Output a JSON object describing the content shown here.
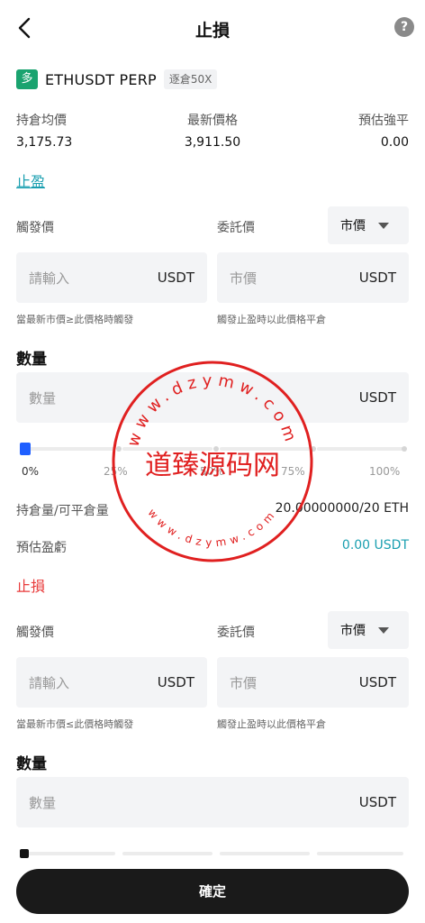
{
  "header": {
    "title": "止損",
    "help_icon": "help-circle-icon",
    "help_glyph": "?"
  },
  "symbol": {
    "direction": "多",
    "name": "ETHUSDT PERP",
    "mode": "逐倉50X",
    "direction_color": "#1aa36f"
  },
  "stats": {
    "labels": [
      "持倉均價",
      "最新價格",
      "預估強平"
    ],
    "values": [
      "3,175.73",
      "3,911.50",
      "0.00"
    ]
  },
  "take_profit": {
    "title": "止盈",
    "trigger_label": "觸發價",
    "order_label": "委託價",
    "order_type": "市價",
    "trigger_input": {
      "placeholder": "請輸入",
      "unit": "USDT"
    },
    "order_input": {
      "placeholder": "市價",
      "unit": "USDT"
    },
    "trigger_hint": "當最新市價≥此價格時觸發",
    "order_hint": "觸發止盈時以此價格平倉",
    "qty_title": "數量",
    "qty_input": {
      "placeholder": "數量",
      "unit": "USDT"
    },
    "slider_value_percent": 0,
    "slider_labels": [
      "0%",
      "25%",
      "50%",
      "75%",
      "100%"
    ],
    "position_label": "持倉量/可平倉量",
    "position_value": "20.00000000/20 ETH",
    "pnl_label": "預估盈虧",
    "pnl_value": "0.00 USDT"
  },
  "stop_loss": {
    "title": "止損",
    "trigger_label": "觸發價",
    "order_label": "委託價",
    "order_type": "市價",
    "trigger_input": {
      "placeholder": "請輸入",
      "unit": "USDT"
    },
    "order_input": {
      "placeholder": "市價",
      "unit": "USDT"
    },
    "trigger_hint": "當最新市價≤此價格時觸發",
    "order_hint": "觸發止盈時以此價格平倉",
    "qty_title": "數量",
    "qty_input": {
      "placeholder": "數量",
      "unit": "USDT"
    },
    "slider_value_percent": 0
  },
  "confirm_label": "確定",
  "watermark": {
    "center_text": "道臻源码网",
    "ring_text_top": "www.dzymw.com",
    "ring_text_bottom": "www.dzymw.com",
    "color": "#e02020"
  },
  "colors": {
    "accent": "#1a9fb0",
    "danger": "#e83a3a",
    "primary_button": "#1a1a1a",
    "slider_handle_tp": "#1f5fff",
    "slider_handle_sl": "#111111"
  }
}
